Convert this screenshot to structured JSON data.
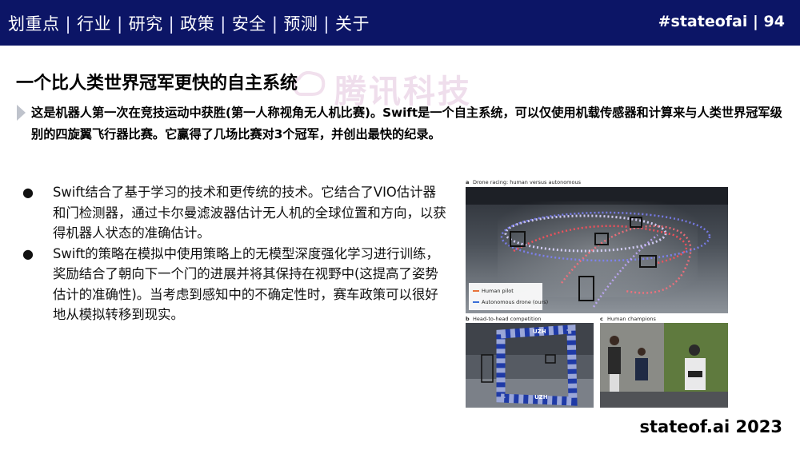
{
  "header": {
    "nav": [
      "划重点",
      "行业",
      "研究",
      "政策",
      "安全",
      "预测",
      "关于"
    ],
    "nav_separator": "|",
    "page_ref": "#stateofai | 94",
    "bg_color": "#0c1566"
  },
  "watermark": {
    "text": "腾讯科技"
  },
  "title": "一个比人类世界冠军更快的自主系统",
  "summary": "这是机器人第一次在竞技运动中获胜(第一人称视角无人机比赛)。Swift是一个自主系统，可以仅使用机载传感器和计算来与人类世界冠军级别的四旋翼飞行器比赛。它赢得了几场比赛对3个冠军，并创出最快的纪录。",
  "bullets": [
    "Swift结合了基于学习的技术和更传统的技术。它结合了VIO估计器和门检测器，通过卡尔曼滤波器估计无人机的全球位置和方向，以获得机器人状态的准确估计。",
    "Swift的策略在模拟中使用策略上的无模型深度强化学习进行训练，奖励结合了朝向下一个门的进展并将其保持在视野中(这提高了姿势估计的准确性)。当考虑到感知中的不确定性时，赛车政策可以很好地从模拟转移到现实。"
  ],
  "figure": {
    "panel_a": {
      "letter": "a",
      "caption": "Drone racing: human versus autonomous",
      "legend": [
        "Human pilot",
        "Autonomous drone (ours)"
      ]
    },
    "panel_b": {
      "letter": "b",
      "caption": "Head-to-head competition",
      "gate_text": "UZH"
    },
    "panel_c": {
      "letter": "c",
      "caption": "Human champions"
    }
  },
  "footer": "stateof.ai 2023"
}
